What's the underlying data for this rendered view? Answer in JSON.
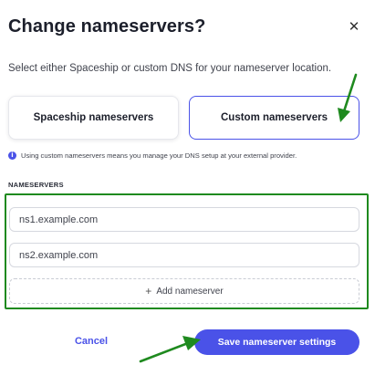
{
  "dialog": {
    "title": "Change nameservers?",
    "close_icon": "close-icon",
    "subtitle": "Select either Spaceship or custom DNS for your nameserver location.",
    "options": {
      "spaceship_label": "Spaceship nameservers",
      "custom_label": "Custom nameservers",
      "selected": "custom"
    },
    "info": {
      "icon": "info-icon",
      "text": "Using custom nameservers means you manage your DNS setup at your external provider."
    },
    "nameservers": {
      "section_label": "NAMESERVERS",
      "inputs": [
        {
          "value": "ns1.example.com"
        },
        {
          "value": "ns2.example.com"
        }
      ],
      "add_label": "Add nameserver",
      "add_icon": "plus-icon"
    },
    "actions": {
      "cancel_label": "Cancel",
      "save_label": "Save nameserver settings"
    }
  },
  "colors": {
    "accent": "#4a52e8",
    "annotation": "#1f8a1f"
  }
}
